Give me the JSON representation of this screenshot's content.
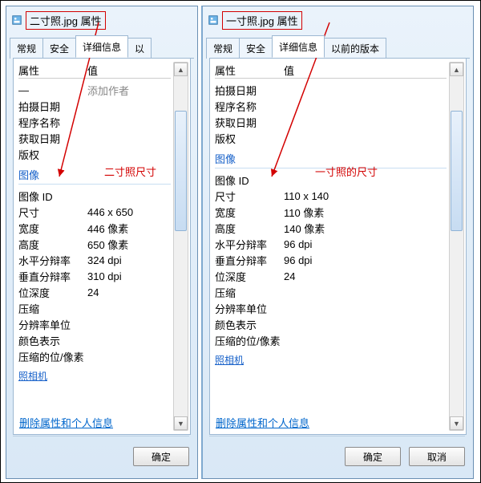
{
  "chart_data": null,
  "left": {
    "title": "二寸照.jpg 属性",
    "tabs": [
      "常规",
      "安全",
      "详细信息",
      "以"
    ],
    "activeTab": 2,
    "header": {
      "keyLabel": "属性",
      "valLabel": "值"
    },
    "addAuthor": "添加作者",
    "preRows": [
      {
        "k": "拍摄日期",
        "v": ""
      },
      {
        "k": "程序名称",
        "v": ""
      },
      {
        "k": "获取日期",
        "v": ""
      },
      {
        "k": "版权",
        "v": ""
      }
    ],
    "sectionTitle": "图像",
    "rows": [
      {
        "k": "图像 ID",
        "v": ""
      },
      {
        "k": "尺寸",
        "v": "446 x 650"
      },
      {
        "k": "宽度",
        "v": "446 像素"
      },
      {
        "k": "高度",
        "v": "650 像素"
      },
      {
        "k": "水平分辩率",
        "v": "324 dpi"
      },
      {
        "k": "垂直分辩率",
        "v": "310 dpi"
      },
      {
        "k": "位深度",
        "v": "24"
      },
      {
        "k": "压缩",
        "v": ""
      },
      {
        "k": "分辨率单位",
        "v": ""
      },
      {
        "k": "颜色表示",
        "v": ""
      },
      {
        "k": "压缩的位/像素",
        "v": ""
      }
    ],
    "cutoff": "照相机",
    "annotation": "二寸照尺寸",
    "link": "删除属性和个人信息",
    "ok": "确定"
  },
  "right": {
    "title": "一寸照.jpg 属性",
    "tabs": [
      "常规",
      "安全",
      "详细信息",
      "以前的版本"
    ],
    "activeTab": 2,
    "header": {
      "keyLabel": "属性",
      "valLabel": "值"
    },
    "preRows": [
      {
        "k": "拍摄日期",
        "v": ""
      },
      {
        "k": "程序名称",
        "v": ""
      },
      {
        "k": "获取日期",
        "v": ""
      },
      {
        "k": "版权",
        "v": ""
      }
    ],
    "sectionTitle": "图像",
    "rows": [
      {
        "k": "图像 ID",
        "v": ""
      },
      {
        "k": "尺寸",
        "v": "110 x 140"
      },
      {
        "k": "宽度",
        "v": "110 像素"
      },
      {
        "k": "高度",
        "v": "140 像素"
      },
      {
        "k": "水平分辩率",
        "v": "96 dpi"
      },
      {
        "k": "垂直分辩率",
        "v": "96 dpi"
      },
      {
        "k": "位深度",
        "v": "24"
      },
      {
        "k": "压缩",
        "v": ""
      },
      {
        "k": "分辨率单位",
        "v": ""
      },
      {
        "k": "颜色表示",
        "v": ""
      },
      {
        "k": "压缩的位/像素",
        "v": ""
      }
    ],
    "cutoff": "照相机",
    "annotation": "一寸照的尺寸",
    "link": "删除属性和个人信息",
    "ok": "确定",
    "cancel": "取消"
  }
}
